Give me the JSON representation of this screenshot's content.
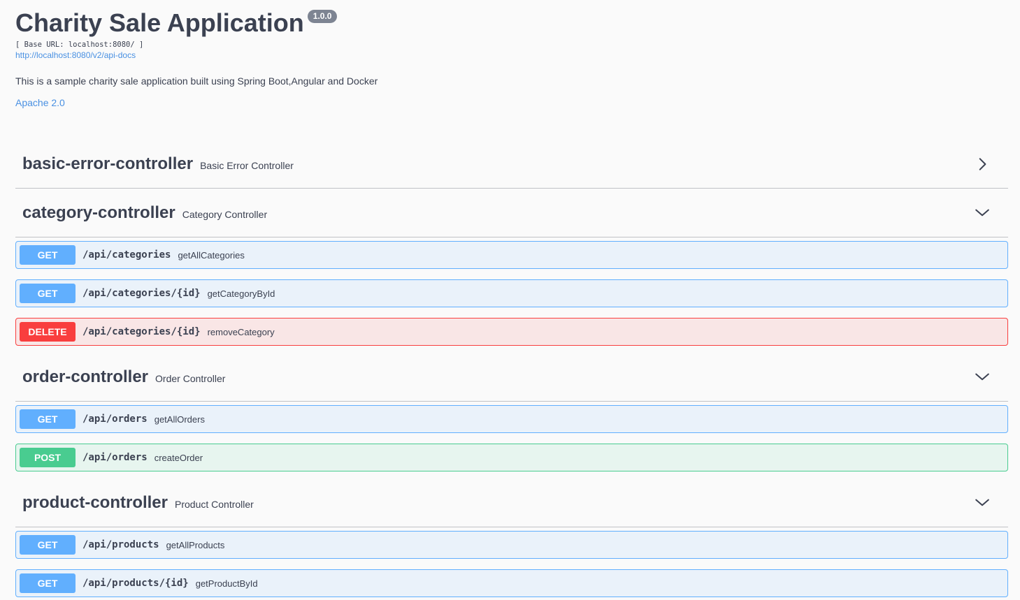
{
  "info": {
    "title": "Charity Sale Application",
    "version": "1.0.0",
    "base_url": "[ Base URL: localhost:8080/ ]",
    "api_docs_link": "http://localhost:8080/v2/api-docs",
    "description": "This is a sample charity sale application built using Spring Boot,Angular and Docker",
    "license": "Apache 2.0"
  },
  "tags": [
    {
      "name": "basic-error-controller",
      "description": "Basic Error Controller",
      "expanded": false,
      "icon": "chevron-right-icon"
    },
    {
      "name": "category-controller",
      "description": "Category Controller",
      "expanded": true,
      "icon": "chevron-down-icon"
    },
    {
      "name": "order-controller",
      "description": "Order Controller",
      "expanded": true,
      "icon": "chevron-down-icon"
    },
    {
      "name": "product-controller",
      "description": "Product Controller",
      "expanded": true,
      "icon": "chevron-down-icon"
    }
  ],
  "operations": {
    "category": [
      {
        "method": "GET",
        "path": "/api/categories",
        "summary": "getAllCategories"
      },
      {
        "method": "GET",
        "path": "/api/categories/{id}",
        "summary": "getCategoryById"
      },
      {
        "method": "DELETE",
        "path": "/api/categories/{id}",
        "summary": "removeCategory"
      }
    ],
    "order": [
      {
        "method": "GET",
        "path": "/api/orders",
        "summary": "getAllOrders"
      },
      {
        "method": "POST",
        "path": "/api/orders",
        "summary": "createOrder"
      }
    ],
    "product": [
      {
        "method": "GET",
        "path": "/api/products",
        "summary": "getAllProducts"
      },
      {
        "method": "GET",
        "path": "/api/products/{id}",
        "summary": "getProductById"
      }
    ]
  },
  "colors": {
    "get": "#61affe",
    "post": "#49cc90",
    "delete": "#f93e3e",
    "link": "#4990e2",
    "text": "#3b4151",
    "version_badge": "#7d8492"
  }
}
